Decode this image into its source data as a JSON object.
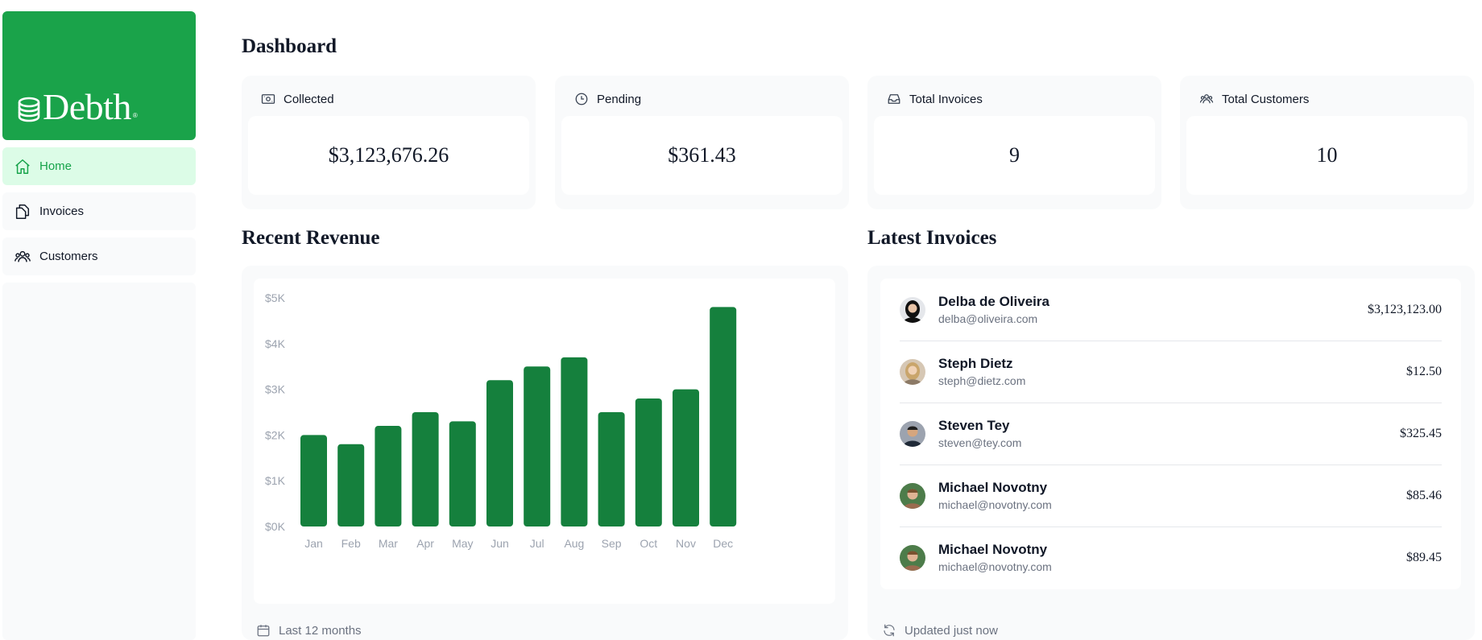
{
  "brand": {
    "name": "Debth",
    "mark": "®"
  },
  "nav": {
    "items": [
      {
        "label": "Home",
        "icon": "home-icon",
        "active": true
      },
      {
        "label": "Invoices",
        "icon": "documents-icon",
        "active": false
      },
      {
        "label": "Customers",
        "icon": "users-icon",
        "active": false
      }
    ]
  },
  "page": {
    "title": "Dashboard"
  },
  "cards": [
    {
      "label": "Collected",
      "icon": "banknote-icon",
      "value": "$3,123,676.26"
    },
    {
      "label": "Pending",
      "icon": "clock-icon",
      "value": "$361.43"
    },
    {
      "label": "Total Invoices",
      "icon": "inbox-icon",
      "value": "9"
    },
    {
      "label": "Total Customers",
      "icon": "user-group-icon",
      "value": "10"
    }
  ],
  "revenue": {
    "title": "Recent Revenue",
    "footer": "Last 12 months"
  },
  "chart_data": {
    "type": "bar",
    "categories": [
      "Jan",
      "Feb",
      "Mar",
      "Apr",
      "May",
      "Jun",
      "Jul",
      "Aug",
      "Sep",
      "Oct",
      "Nov",
      "Dec"
    ],
    "values": [
      2000,
      1800,
      2200,
      2500,
      2300,
      3200,
      3500,
      3700,
      2500,
      2800,
      3000,
      4800
    ],
    "yticks": [
      "$0K",
      "$1K",
      "$2K",
      "$3K",
      "$4K",
      "$5K"
    ],
    "ylim": [
      0,
      5000
    ],
    "grid": false,
    "color": "#15803d"
  },
  "invoices": {
    "title": "Latest Invoices",
    "footer": "Updated just now",
    "items": [
      {
        "name": "Delba de Oliveira",
        "email": "delba@oliveira.com",
        "amount": "$3,123,123.00"
      },
      {
        "name": "Steph Dietz",
        "email": "steph@dietz.com",
        "amount": "$12.50"
      },
      {
        "name": "Steven Tey",
        "email": "steven@tey.com",
        "amount": "$325.45"
      },
      {
        "name": "Michael Novotny",
        "email": "michael@novotny.com",
        "amount": "$85.46"
      },
      {
        "name": "Michael Novotny",
        "email": "michael@novotny.com",
        "amount": "$89.45"
      }
    ]
  },
  "colors": {
    "brand_green": "#1aa34a",
    "active_nav_bg": "#dcfce7",
    "active_nav_text": "#16a34a",
    "bar_green": "#15803d",
    "panel_bg": "#f9fafb"
  }
}
